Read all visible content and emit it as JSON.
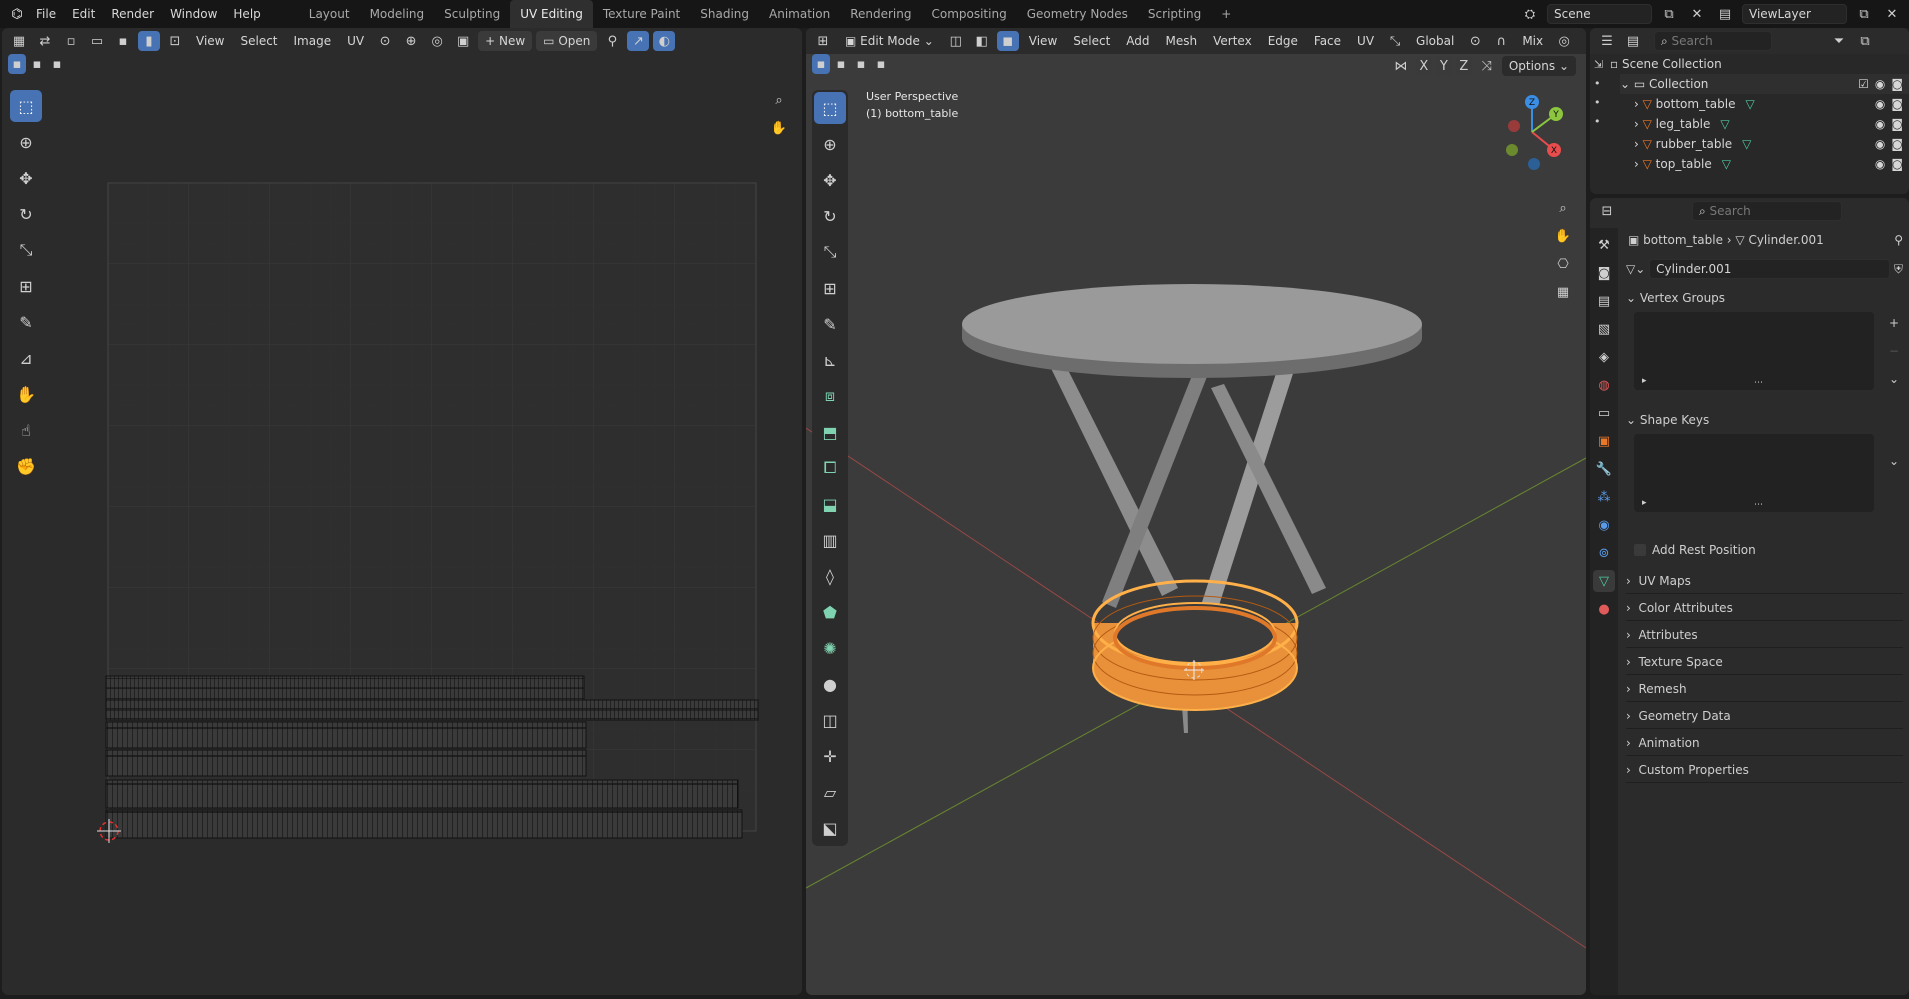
{
  "menu": {
    "items": [
      "File",
      "Edit",
      "Render",
      "Window",
      "Help"
    ],
    "workspaces": [
      "Layout",
      "Modeling",
      "Sculpting",
      "UV Editing",
      "Texture Paint",
      "Shading",
      "Animation",
      "Rendering",
      "Compositing",
      "Geometry Nodes",
      "Scripting"
    ],
    "active_workspace": "UV Editing",
    "add_tab": "+",
    "scene": "Scene",
    "view_layer": "ViewLayer"
  },
  "uv_editor": {
    "menus": [
      "View",
      "Select",
      "Image",
      "UV"
    ],
    "new_label": "New",
    "open_label": "Open"
  },
  "viewport": {
    "mode": "Edit Mode",
    "menus": [
      "View",
      "Select",
      "Add",
      "Mesh",
      "Vertex",
      "Edge",
      "Face",
      "UV"
    ],
    "orientation": "Global",
    "snap": "Mix",
    "options": "Options",
    "overlay_line1": "User Perspective",
    "overlay_line2": "(1) bottom_table",
    "axes": [
      "X",
      "Y",
      "Z"
    ],
    "gizmo": {
      "x": "X",
      "y": "Y",
      "z": "Z"
    }
  },
  "outliner": {
    "search_placeholder": "Search",
    "scene_collection": "Scene Collection",
    "collection": "Collection",
    "objects": [
      "bottom_table",
      "leg_table",
      "rubber_table",
      "top_table"
    ]
  },
  "properties": {
    "search_placeholder": "Search",
    "breadcrumb_object": "bottom_table",
    "breadcrumb_mesh": "Cylinder.001",
    "mesh_name": "Cylinder.001",
    "vertex_groups": "Vertex Groups",
    "shape_keys": "Shape Keys",
    "add_rest_position": "Add Rest Position",
    "sections": [
      "UV Maps",
      "Color Attributes",
      "Attributes",
      "Texture Space",
      "Remesh",
      "Geometry Data",
      "Animation",
      "Custom Properties"
    ]
  },
  "colors": {
    "accent": "#4772b3",
    "selection": "#ff8c1a",
    "x_axis": "#e84c4c",
    "y_axis": "#8cc63f",
    "z_axis": "#3b8ee5",
    "object_orange": "#e8782a",
    "mesh_green": "#4ec9a0"
  }
}
